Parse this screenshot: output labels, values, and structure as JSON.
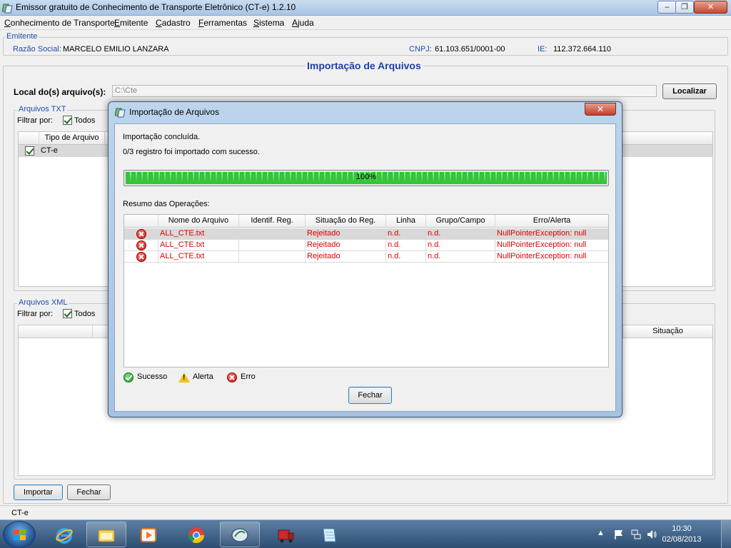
{
  "window": {
    "title": "Emissor gratuito de Conhecimento de Transporte Eletrônico (CT-e) 1.2.10",
    "minimize": "–",
    "maximize": "❐",
    "close": "✕"
  },
  "menu": {
    "items": [
      {
        "pre": "",
        "u": "C",
        "post": "onhecimento de Transporte"
      },
      {
        "pre": "",
        "u": "E",
        "post": "mitente"
      },
      {
        "pre": "",
        "u": "C",
        "post": "adastro"
      },
      {
        "pre": "",
        "u": "F",
        "post": "erramentas"
      },
      {
        "pre": "",
        "u": "S",
        "post": "istema"
      },
      {
        "pre": "",
        "u": "A",
        "post": "juda"
      }
    ]
  },
  "emitente": {
    "legend": "Emitente",
    "razao_label": "Razão Social:",
    "razao_value": "MARCELO EMILIO LANZARA",
    "cnpj_label": "CNPJ:",
    "cnpj_value": "61.103.651/0001-00",
    "ie_label": "IE:",
    "ie_value": "112.372.664.110"
  },
  "panel": {
    "title": "Importação de Arquivos",
    "local_label": "Local do(s) arquivo(s):",
    "local_value": "C:\\Cte",
    "localizar_button": "Localizar"
  },
  "txt_section": {
    "legend": "Arquivos TXT",
    "filter_label": "Filtrar por:",
    "todos_label": "Todos",
    "col_tipo": "Tipo de Arquivo",
    "row_value": "CT-e"
  },
  "xml_section": {
    "legend": "Arquivos XML",
    "filter_label": "Filtrar por:",
    "todos_label": "Todos",
    "col_situacao": "Situação"
  },
  "bottom_buttons": {
    "importar": "Importar",
    "fechar": "Fechar"
  },
  "status": {
    "text": "CT-e"
  },
  "dialog": {
    "title": "Importação de Arquivos",
    "close": "✕",
    "message_1": "Importação concluída.",
    "message_2": "0/3 registro foi importado com sucesso.",
    "progress_text": "100%",
    "progress_value": 1.0,
    "resumo_label": "Resumo das Operações:",
    "columns": [
      "Nome do Arquivo",
      "Identif. Reg.",
      "Situação do Reg.",
      "Linha",
      "Grupo/Campo",
      "Erro/Alerta"
    ],
    "rows": [
      {
        "arquivo": "ALL_CTE.txt",
        "identif": "",
        "situacao": "Rejeitado",
        "linha": "n.d.",
        "grupo": "n.d.",
        "erro": "NullPointerException: null"
      },
      {
        "arquivo": "ALL_CTE.txt",
        "identif": "",
        "situacao": "Rejeitado",
        "linha": "n.d.",
        "grupo": "n.d.",
        "erro": "NullPointerException: null"
      },
      {
        "arquivo": "ALL_CTE.txt",
        "identif": "",
        "situacao": "Rejeitado",
        "linha": "n.d.",
        "grupo": "n.d.",
        "erro": "NullPointerException: null"
      }
    ],
    "legend_sucesso": "Sucesso",
    "legend_alerta": "Alerta",
    "legend_erro": "Erro",
    "fechar_button": "Fechar"
  },
  "taskbar": {
    "clock_time": "10:30",
    "clock_date": "02/08/2013",
    "tray_arrow": "▲"
  },
  "colors": {
    "accent_blue": "#1f3fa8",
    "error_red": "#e00000",
    "progress_green": "#35c43a"
  }
}
